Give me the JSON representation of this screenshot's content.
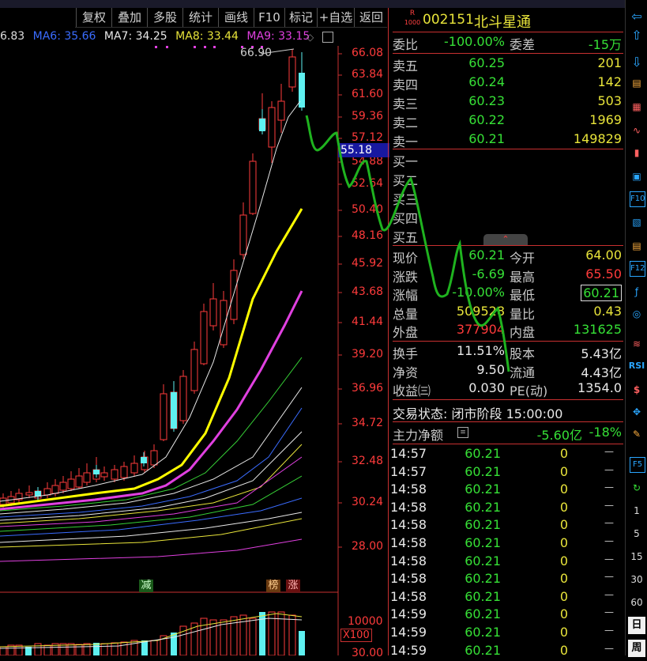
{
  "toolbar": {
    "buttons": [
      "复权",
      "叠加",
      "多股",
      "统计",
      "画线",
      "F10",
      "标记",
      "+自选",
      "返回"
    ]
  },
  "ma_legend": {
    "prefix": "6.83",
    "ma6": "MA6: 35.66",
    "ma7": "MA7: 34.25",
    "ma8": "MA8: 33.44",
    "ma9": "MA9: 33.15"
  },
  "price_axis": [
    "66.08",
    "63.84",
    "61.60",
    "59.36",
    "57.12",
    "54.88",
    "52.64",
    "50.40",
    "48.16",
    "45.92",
    "43.68",
    "41.44",
    "39.20",
    "36.96",
    "34.72",
    "32.48",
    "30.24",
    "28.00"
  ],
  "price_axis_bottom": "30.00",
  "current_marker": "55.18",
  "peak_label": "66.90",
  "tags": {
    "jian": "减",
    "bang": "榜",
    "zhang": "涨"
  },
  "volume_axis": {
    "label": "10000",
    "unit": "X100"
  },
  "stock": {
    "badge_top": "R",
    "badge_bottom": "1000",
    "code": "002151",
    "name": "北斗星通"
  },
  "quote": {
    "weibi_label": "委比",
    "weibi_value": "-100.00%",
    "weicha_label": "委差",
    "weicha_value": "-15万",
    "sell": [
      {
        "label": "卖五",
        "price": "60.25",
        "vol": "201"
      },
      {
        "label": "卖四",
        "price": "60.24",
        "vol": "142"
      },
      {
        "label": "卖三",
        "price": "60.23",
        "vol": "503"
      },
      {
        "label": "卖二",
        "price": "60.22",
        "vol": "1969"
      },
      {
        "label": "卖一",
        "price": "60.21",
        "vol": "149829"
      }
    ],
    "buy": [
      "买一",
      "买二",
      "买三",
      "买四",
      "买五"
    ],
    "stats": [
      {
        "l1": "现价",
        "v1": "60.21",
        "l2": "今开",
        "v2": "64.00"
      },
      {
        "l1": "涨跌",
        "v1": "-6.69",
        "l2": "最高",
        "v2": "65.50"
      },
      {
        "l1": "涨幅",
        "v1": "-10.00%",
        "l2": "最低",
        "v2": "60.21"
      },
      {
        "l1": "总量",
        "v1": "509528",
        "l2": "量比",
        "v2": "0.43"
      },
      {
        "l1": "外盘",
        "v1": "377904",
        "l2": "内盘",
        "v2": "131625"
      }
    ],
    "stats2": [
      {
        "l1": "换手",
        "v1": "11.51%",
        "l2": "股本",
        "v2": "5.43亿"
      },
      {
        "l1": "净资",
        "v1": "9.50",
        "l2": "流通",
        "v2": "4.43亿"
      },
      {
        "l1": "收益㈢",
        "v1": "0.030",
        "l2": "PE(动)",
        "v2": "1354.0"
      }
    ],
    "trade_status": "交易状态: 闭市阶段 15:00:00",
    "main_flow_label": "主力净额",
    "main_flow_value": "-5.60亿",
    "main_flow_pct": "-18%"
  },
  "ticks": [
    {
      "time": "14:57",
      "price": "60.21",
      "vol": "0",
      "dir": "—"
    },
    {
      "time": "14:57",
      "price": "60.21",
      "vol": "0",
      "dir": "—"
    },
    {
      "time": "14:58",
      "price": "60.21",
      "vol": "0",
      "dir": "—"
    },
    {
      "time": "14:58",
      "price": "60.21",
      "vol": "0",
      "dir": "—"
    },
    {
      "time": "14:58",
      "price": "60.21",
      "vol": "0",
      "dir": "—"
    },
    {
      "time": "14:58",
      "price": "60.21",
      "vol": "0",
      "dir": "—"
    },
    {
      "time": "14:58",
      "price": "60.21",
      "vol": "0",
      "dir": "—"
    },
    {
      "time": "14:58",
      "price": "60.21",
      "vol": "0",
      "dir": "—"
    },
    {
      "time": "14:58",
      "price": "60.21",
      "vol": "0",
      "dir": "—"
    },
    {
      "time": "14:59",
      "price": "60.21",
      "vol": "0",
      "dir": "—"
    },
    {
      "time": "14:59",
      "price": "60.21",
      "vol": "0",
      "dir": "—"
    },
    {
      "time": "14:59",
      "price": "60.21",
      "vol": "0",
      "dir": "—"
    }
  ],
  "sidebar_periods": [
    "1",
    "5",
    "15",
    "30",
    "60",
    "日",
    "周"
  ],
  "sidebar_codes": [
    "F10",
    "F12",
    "RSI",
    "F5"
  ],
  "colors": {
    "up": "#ff3b3b",
    "down": "#5ef0f0",
    "green": "#36e036",
    "yellow": "#e8e43a",
    "axis": "#c83030"
  }
}
